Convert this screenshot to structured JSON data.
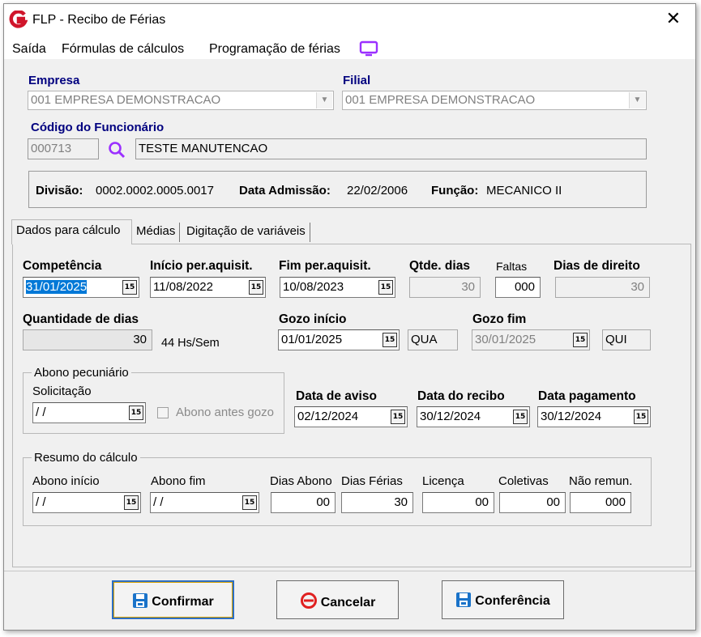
{
  "window": {
    "title": "FLP - Recibo de Férias"
  },
  "menu": [
    "Saída",
    "Fórmulas de cálculos",
    "Programação de férias"
  ],
  "header": {
    "empresa_label": "Empresa",
    "empresa_value": "001 EMPRESA DEMONSTRACAO",
    "filial_label": "Filial",
    "filial_value": "001 EMPRESA DEMONSTRACAO",
    "codigo_label": "Código do Funcionário",
    "codigo_value": "000713",
    "nome_value": "TESTE MANUTENCAO",
    "divisao_label": "Divisão:",
    "divisao_value": "0002.0002.0005.0017",
    "admissao_label": "Data Admissão:",
    "admissao_value": "22/02/2006",
    "funcao_label": "Função:",
    "funcao_value": "MECANICO II"
  },
  "tabs": [
    "Dados para cálculo",
    "Médias",
    "Digitação de variáveis"
  ],
  "form": {
    "competencia_label": "Competência",
    "competencia_value": "31/01/2025",
    "inicio_label": "Início per.aquisit.",
    "inicio_value": "11/08/2022",
    "fim_label": "Fim per.aquisit.",
    "fim_value": "10/08/2023",
    "qtde_label": "Qtde. dias",
    "qtde_value": "30",
    "faltas_label": "Faltas",
    "faltas_value": "000",
    "direito_label": "Dias de direito",
    "direito_value": "30",
    "quantidade_label": "Quantidade de dias",
    "quantidade_value": "30",
    "hs_sem": "44 Hs/Sem",
    "gozo_inicio_label": "Gozo início",
    "gozo_inicio_value": "01/01/2025",
    "gozo_inicio_dia": "QUA",
    "gozo_fim_label": "Gozo fim",
    "gozo_fim_value": "30/01/2025",
    "gozo_fim_dia": "QUI",
    "abono_group": "Abono pecuniário",
    "solicitacao_label": "Solicitação",
    "solicitacao_value": " / /",
    "abono_antes_label": "Abono antes gozo",
    "aviso_label": "Data de aviso",
    "aviso_value": "02/12/2024",
    "recibo_label": "Data do recibo",
    "recibo_value": "30/12/2024",
    "pagamento_label": "Data pagamento",
    "pagamento_value": "30/12/2024"
  },
  "resumo": {
    "group": "Resumo do cálculo",
    "abono_inicio_label": "Abono início",
    "abono_inicio_value": " / /",
    "abono_fim_label": "Abono fim",
    "abono_fim_value": " / /",
    "dias_abono_label": "Dias Abono",
    "dias_abono_value": "00",
    "dias_ferias_label": "Dias Férias",
    "dias_ferias_value": "30",
    "licenca_label": "Licença",
    "licenca_value": "00",
    "coletivas_label": "Coletivas",
    "coletivas_value": "00",
    "nao_remun_label": "Não remun.",
    "nao_remun_value": "000"
  },
  "buttons": {
    "confirmar": "Confirmar",
    "cancelar": "Cancelar",
    "conferencia": "Conferência"
  },
  "calendar_glyph": "15",
  "colors": {
    "label_blue": "#00007f",
    "accent_purple": "#9b30ff",
    "selection": "#0078d7",
    "cancel_red": "#e02020",
    "save_blue": "#1a73c9"
  }
}
